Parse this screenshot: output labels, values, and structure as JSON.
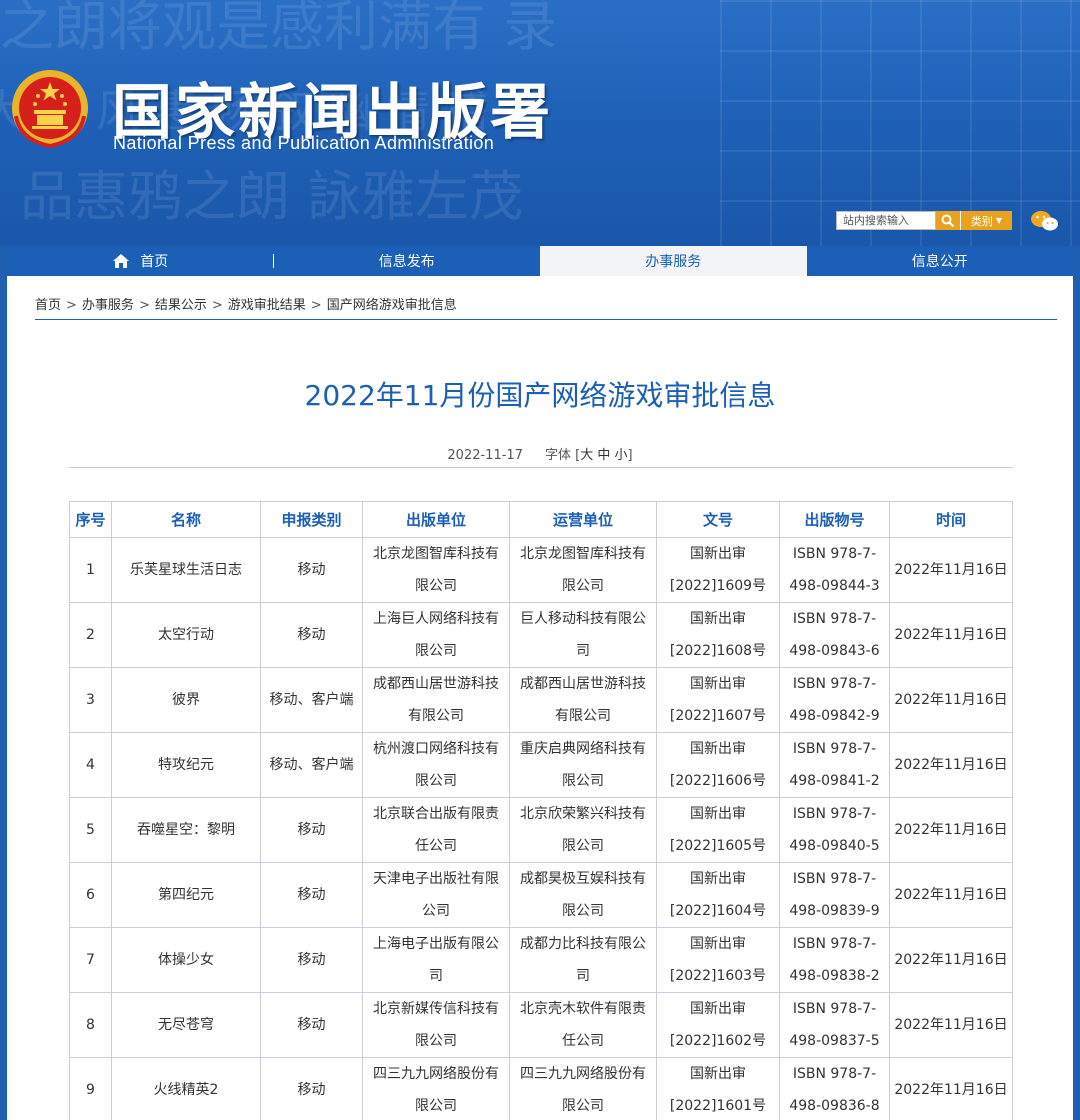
{
  "header": {
    "title": "国家新闻出版署",
    "subtitle": "National  Press and Publication Administration",
    "search_placeholder": "站内搜索输入",
    "category_label": "类别"
  },
  "nav": {
    "items": [
      {
        "label": "首页"
      },
      {
        "label": "信息发布"
      },
      {
        "label": "办事服务"
      },
      {
        "label": "信息公开"
      }
    ]
  },
  "breadcrumb": [
    "首页",
    "办事服务",
    "结果公示",
    "游戏审批结果",
    "国产网络游戏审批信息"
  ],
  "article": {
    "title": "2022年11月份国产网络游戏审批信息",
    "date": "2022-11-17",
    "font_label": "字体 [",
    "font_sizes": [
      "大",
      "中",
      "小"
    ],
    "font_end": "]"
  },
  "table": {
    "headers": [
      "序号",
      "名称",
      "申报类别",
      "出版单位",
      "运营单位",
      "文号",
      "出版物号",
      "时间"
    ],
    "rows": [
      [
        "1",
        "乐芙星球生活日志",
        "移动",
        "北京龙图智库科技有限公司",
        "北京龙图智库科技有限公司",
        "国新出审[2022]1609号",
        "ISBN 978-7-498-09844-3",
        "2022年11月16日"
      ],
      [
        "2",
        "太空行动",
        "移动",
        "上海巨人网络科技有限公司",
        "巨人移动科技有限公司",
        "国新出审[2022]1608号",
        "ISBN 978-7-498-09843-6",
        "2022年11月16日"
      ],
      [
        "3",
        "彼界",
        "移动、客户端",
        "成都西山居世游科技有限公司",
        "成都西山居世游科技有限公司",
        "国新出审[2022]1607号",
        "ISBN 978-7-498-09842-9",
        "2022年11月16日"
      ],
      [
        "4",
        "特攻纪元",
        "移动、客户端",
        "杭州渡口网络科技有限公司",
        "重庆启典网络科技有限公司",
        "国新出审[2022]1606号",
        "ISBN 978-7-498-09841-2",
        "2022年11月16日"
      ],
      [
        "5",
        "吞噬星空：黎明",
        "移动",
        "北京联合出版有限责任公司",
        "北京欣荣繁兴科技有限公司",
        "国新出审[2022]1605号",
        "ISBN 978-7-498-09840-5",
        "2022年11月16日"
      ],
      [
        "6",
        "第四纪元",
        "移动",
        "天津电子出版社有限公司",
        "成都昊极互娱科技有限公司",
        "国新出审[2022]1604号",
        "ISBN 978-7-498-09839-9",
        "2022年11月16日"
      ],
      [
        "7",
        "体操少女",
        "移动",
        "上海电子出版有限公司",
        "成都力比科技有限公司",
        "国新出审[2022]1603号",
        "ISBN 978-7-498-09838-2",
        "2022年11月16日"
      ],
      [
        "8",
        "无尽苍穹",
        "移动",
        "北京新媒传信科技有限公司",
        "北京壳木软件有限责任公司",
        "国新出审[2022]1602号",
        "ISBN 978-7-498-09837-5",
        "2022年11月16日"
      ],
      [
        "9",
        "火线精英2",
        "移动",
        "四三九九网络股份有限公司",
        "四三九九网络股份有限公司",
        "国新出审[2022]1601号",
        "ISBN 978-7-498-09836-8",
        "2022年11月16日"
      ]
    ]
  },
  "colors": {
    "brand_blue": "#1b5fb6",
    "accent_orange": "#e9a21e"
  },
  "icons": [
    "national-emblem-icon",
    "search-icon",
    "chevron-down-icon",
    "wechat-icon",
    "home-icon"
  ]
}
